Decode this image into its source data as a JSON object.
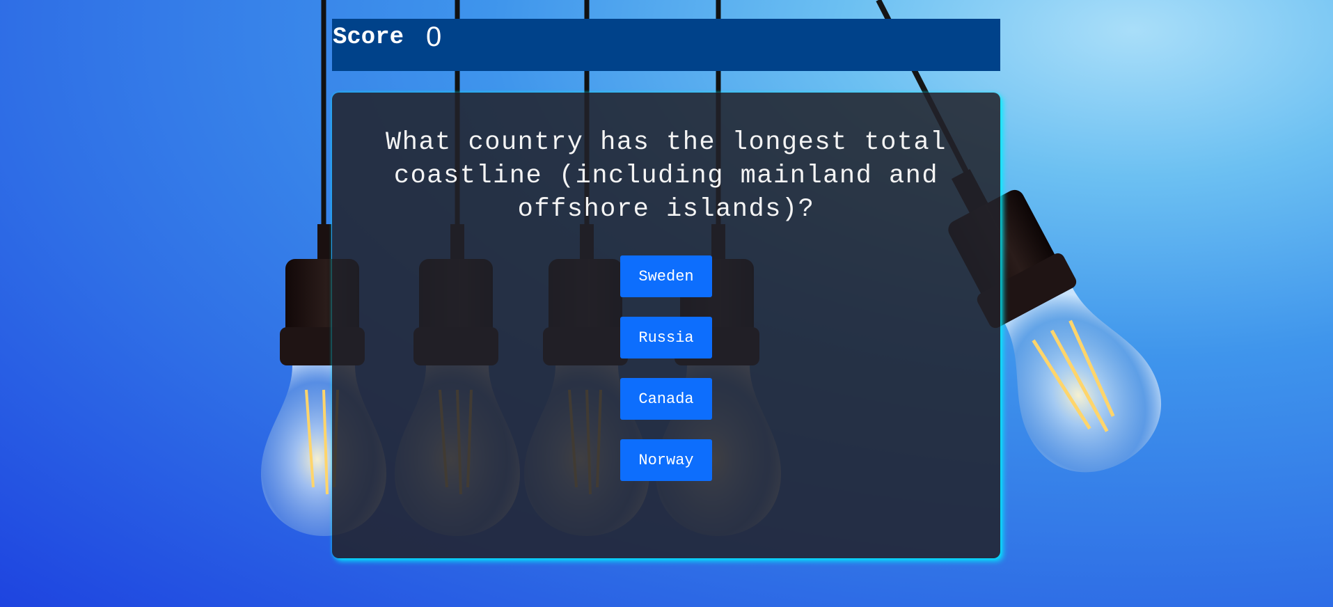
{
  "colors": {
    "score_bar": "#00428a",
    "answer_button": "#0d6efd",
    "card_glow": "#00f0ff"
  },
  "scoreboard": {
    "label": "Score",
    "value": "0"
  },
  "quiz": {
    "question": "What country has the longest total coastline (including mainland and offshore islands)?",
    "answers": [
      "Sweden",
      "Russia",
      "Canada",
      "Norway"
    ]
  },
  "background": {
    "scene": "hanging-light-bulbs-image"
  }
}
